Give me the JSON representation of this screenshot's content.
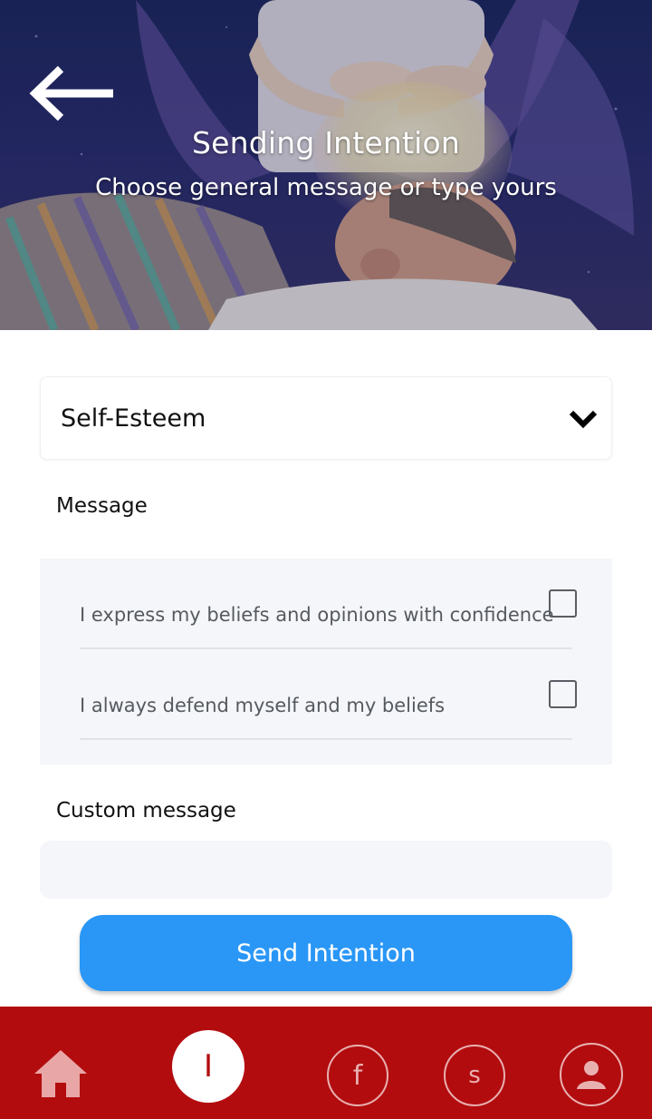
{
  "header": {
    "title": "Sending Intention",
    "subtitle": "Choose general message or type yours",
    "back_icon": "arrow-left-icon"
  },
  "category_select": {
    "selected": "Self-Esteem",
    "icon": "chevron-down-icon"
  },
  "messages": {
    "label": "Message",
    "items": [
      {
        "text": "I express my beliefs and opinions with confidence",
        "checked": false
      },
      {
        "text": "I always defend myself and my beliefs",
        "checked": false
      }
    ]
  },
  "custom": {
    "label": "Custom message",
    "value": "",
    "placeholder": ""
  },
  "send_button": {
    "label": "Send Intention"
  },
  "tabbar": {
    "items": [
      {
        "icon": "home-icon",
        "letter": ""
      },
      {
        "icon": "intention-icon",
        "letter": "I",
        "active": true
      },
      {
        "icon": "facebook-icon",
        "letter": "f"
      },
      {
        "icon": "s-icon",
        "letter": "s"
      },
      {
        "icon": "user-icon",
        "letter": ""
      }
    ]
  },
  "colors": {
    "accent": "#2a97f6",
    "tabbar": "#b20c0f",
    "panel": "#f5f6f9"
  }
}
